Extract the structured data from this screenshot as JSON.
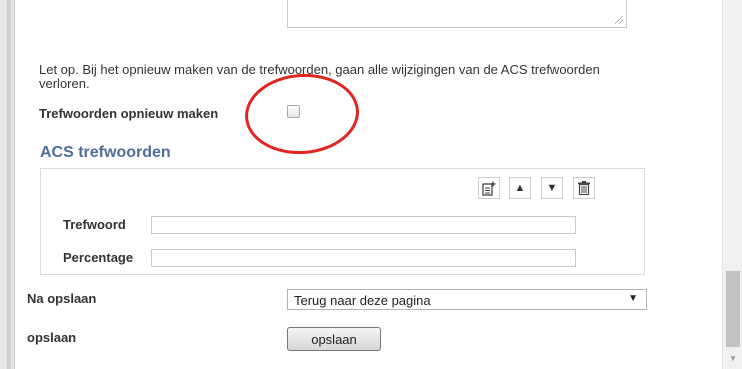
{
  "warning": {
    "line1": "Let op. Bij het opnieuw maken van de trefwoorden, gaan alle wijzigingen van de ACS trefwoorden",
    "line2": "verloren."
  },
  "regenerate": {
    "label": "Trefwoorden opnieuw maken",
    "checked": false
  },
  "acs": {
    "title": "ACS trefwoorden",
    "toolbar": {
      "add_icon": "add-document-icon",
      "up_icon": "arrow-up-icon",
      "down_icon": "arrow-down-icon",
      "delete_icon": "trash-icon"
    },
    "fields": [
      {
        "label": "Trefwoord",
        "value": ""
      },
      {
        "label": "Percentage",
        "value": ""
      }
    ]
  },
  "after_save": {
    "label": "Na opslaan",
    "selected": "Terug naar deze pagina"
  },
  "save": {
    "label": "opslaan",
    "button_label": "opslaan"
  },
  "colors": {
    "section_title": "#4f6d9a",
    "annotation_circle": "#e0241f"
  }
}
